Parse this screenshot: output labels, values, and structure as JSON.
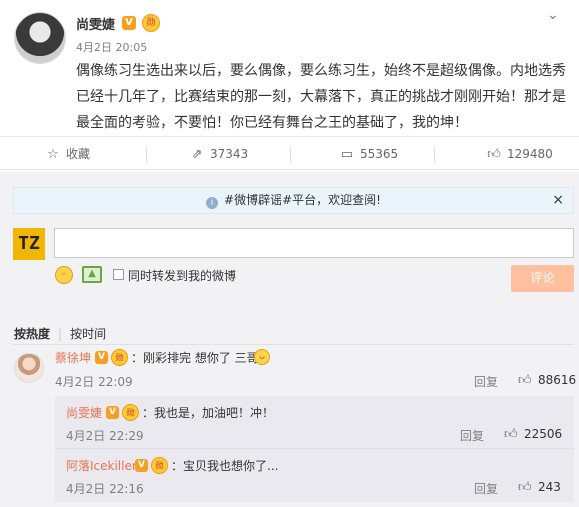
{
  "post": {
    "author": "尚雯婕",
    "verified_badge": "V",
    "medal_badge": "勋",
    "time": "4月2日 20:05",
    "content": "偶像练习生选出来以后，要么偶像，要么练习生，始终不是超级偶像。内地选秀已经十几年了，比赛结束的那一刻，大幕落下，真正的挑战才刚刚开始！那才是最全面的考验，不要怕！你已经有舞台之王的基础了，我的坤！",
    "chevron_icon": "chevron-down-icon"
  },
  "actions": {
    "favorite_label": "收藏",
    "repost_count": "37343",
    "comment_count": "55365",
    "like_count": "129480"
  },
  "comment_box": {
    "notice_text": "#微博辟谣#平台，欢迎查阅!",
    "notice_info_glyph": "i",
    "notice_close": "×",
    "user_logo_text": "TZ",
    "input_value": "",
    "forward_label": "同时转发到我的微博",
    "submit_label": "评论"
  },
  "sort": {
    "hot_label": "按热度",
    "time_label": "按时间"
  },
  "comments": [
    {
      "name": "蔡徐坤",
      "text": "：刚彩排完 想你了 三哥",
      "time": "4月2日 22:09",
      "reply_label": "回复",
      "likes": "88616"
    }
  ],
  "replies": [
    {
      "name": "尚雯婕",
      "text": "：我也是，加油吧！冲！",
      "time": "4月2日 22:29",
      "reply_label": "回复",
      "likes": "22506"
    },
    {
      "name": "阿落Icekiller",
      "text": "：宝贝我也想你了...",
      "time": "4月2日 22:16",
      "reply_label": "回复",
      "likes": "243"
    }
  ],
  "colors": {
    "accent_orange": "#eb7350",
    "submit_disabled": "#ffc09f",
    "notice_bg": "#eaf4fb",
    "comment_bg": "#f2f2f5"
  }
}
